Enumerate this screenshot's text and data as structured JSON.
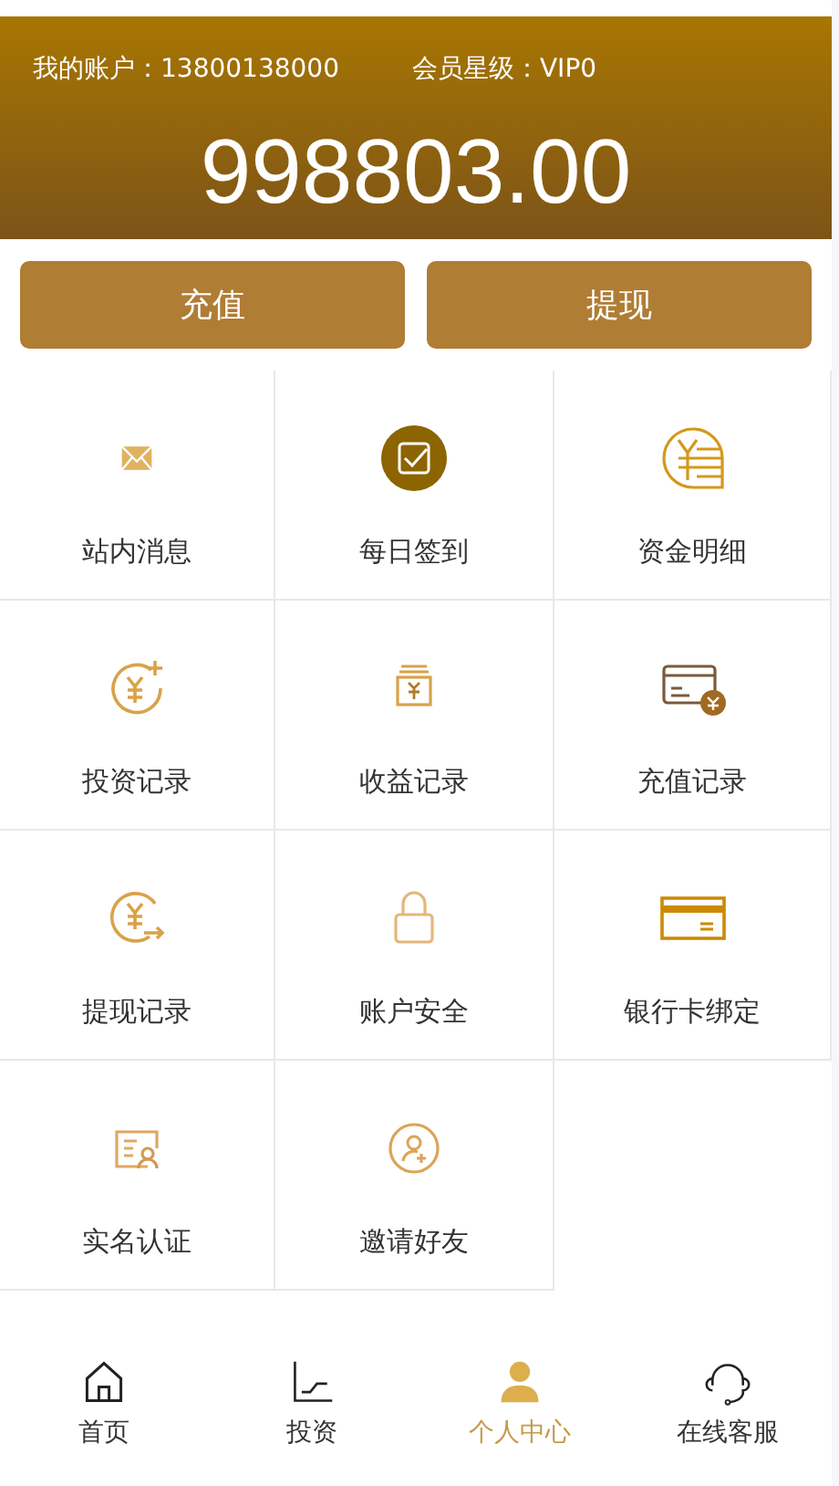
{
  "header": {
    "account_label": "我的账户：13800138000",
    "vip_label": "会员星级：VIP0",
    "balance": "998803.00"
  },
  "actions": [
    "充值",
    "提现"
  ],
  "menu": [
    {
      "label": "站内消息",
      "kind": "mail"
    },
    {
      "label": "每日签到",
      "kind": "checkin"
    },
    {
      "label": "资金明细",
      "kind": "funds"
    },
    {
      "label": "投资记录",
      "kind": "invest"
    },
    {
      "label": "收益记录",
      "kind": "income"
    },
    {
      "label": "充值记录",
      "kind": "recharge"
    },
    {
      "label": "提现记录",
      "kind": "withdraw"
    },
    {
      "label": "账户安全",
      "kind": "lock"
    },
    {
      "label": "银行卡绑定",
      "kind": "card"
    },
    {
      "label": "实名认证",
      "kind": "idcard"
    },
    {
      "label": "邀请好友",
      "kind": "invite"
    }
  ],
  "tab_bar": [
    {
      "label": "首页",
      "kind": "home",
      "selected": false
    },
    {
      "label": "投资",
      "kind": "chart",
      "selected": false
    },
    {
      "label": "个人中心",
      "kind": "user",
      "selected": true
    },
    {
      "label": "在线客服",
      "kind": "headset",
      "selected": false
    }
  ]
}
